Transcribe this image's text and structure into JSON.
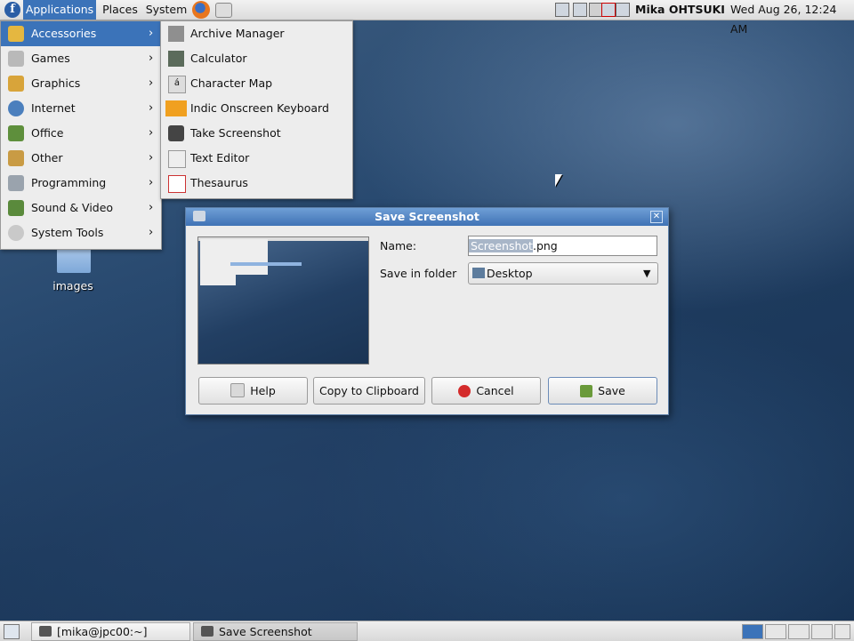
{
  "top_panel": {
    "menus": {
      "applications": "Applications",
      "places": "Places",
      "system": "System"
    },
    "user": "Mika OHTSUKI",
    "clock": "Wed Aug 26, 12:24 AM"
  },
  "applications_menu": {
    "items": [
      {
        "label": "Accessories",
        "icon": "accessories-icon",
        "active": true
      },
      {
        "label": "Games",
        "icon": "games-icon"
      },
      {
        "label": "Graphics",
        "icon": "graphics-icon"
      },
      {
        "label": "Internet",
        "icon": "internet-icon"
      },
      {
        "label": "Office",
        "icon": "office-icon"
      },
      {
        "label": "Other",
        "icon": "other-icon"
      },
      {
        "label": "Programming",
        "icon": "programming-icon"
      },
      {
        "label": "Sound & Video",
        "icon": "sound-video-icon"
      },
      {
        "label": "System Tools",
        "icon": "system-tools-icon"
      }
    ]
  },
  "accessories_menu": {
    "items": [
      {
        "label": "Archive Manager",
        "icon": "archive-manager-icon"
      },
      {
        "label": "Calculator",
        "icon": "calculator-icon"
      },
      {
        "label": "Character Map",
        "icon": "character-map-icon"
      },
      {
        "label": "Indic Onscreen Keyboard",
        "icon": "keyboard-icon"
      },
      {
        "label": "Take Screenshot",
        "icon": "camera-icon"
      },
      {
        "label": "Text Editor",
        "icon": "text-editor-icon"
      },
      {
        "label": "Thesaurus",
        "icon": "thesaurus-icon"
      }
    ]
  },
  "desktop": {
    "icons": [
      {
        "label": "images",
        "icon": "folder-icon"
      }
    ]
  },
  "dialog": {
    "title": "Save Screenshot",
    "name_label": "Name:",
    "name_value_selected": "Screenshot",
    "name_value_rest": ".png",
    "folder_label": "Save in folder",
    "folder_value": "Desktop",
    "buttons": {
      "help": "Help",
      "copy": "Copy to Clipboard",
      "cancel": "Cancel",
      "save": "Save"
    }
  },
  "bottom_panel": {
    "tasks": [
      {
        "label": "[mika@jpc00:~]",
        "icon": "terminal-icon"
      },
      {
        "label": "Save Screenshot",
        "icon": "camera-icon",
        "active": true
      }
    ]
  },
  "colors": {
    "selection": "#3b73b9",
    "titlebar": "#4a7fc0",
    "cancel_red": "#d42b2b"
  }
}
